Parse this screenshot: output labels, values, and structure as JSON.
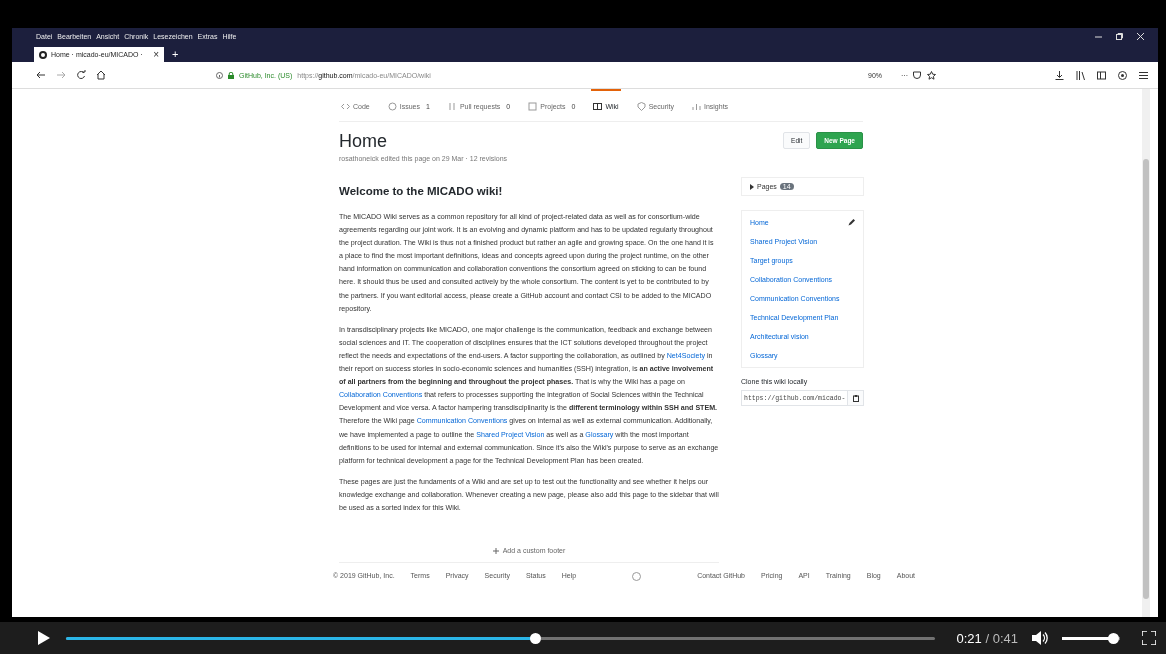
{
  "browser": {
    "menu": [
      "Datei",
      "Bearbeiten",
      "Ansicht",
      "Chronik",
      "Lesezeichen",
      "Extras",
      "Hilfe"
    ],
    "tab": {
      "title": "Home · micado-eu/MICADO ·",
      "close": "×"
    },
    "new_tab": "+",
    "address": {
      "site_info": "GitHub, Inc. (US)",
      "url_prefix": "https://",
      "url_host": "github.com",
      "url_path": "/micado-eu/MICADO/wiki",
      "zoom": "90%",
      "more": "···"
    }
  },
  "repo_nav": [
    {
      "label": "Code",
      "selected": false
    },
    {
      "label": "Issues",
      "count": "1",
      "selected": false
    },
    {
      "label": "Pull requests",
      "count": "0",
      "selected": false
    },
    {
      "label": "Projects",
      "count": "0",
      "selected": false
    },
    {
      "label": "Wiki",
      "selected": true
    },
    {
      "label": "Security",
      "selected": false
    },
    {
      "label": "Insights",
      "selected": false
    }
  ],
  "wiki": {
    "title": "Home",
    "meta": "rosathoneick edited this page on 29 Mar · 12 revisions",
    "edit_button": "Edit",
    "new_page_button": "New Page",
    "heading": "Welcome to the MICADO wiki!",
    "paragraphs": [
      [
        {
          "kind": "text",
          "text": "The MICADO Wiki serves as a common repository for all kind of project-related data as well as for consortium-wide agreements regarding our joint work. It is an evolving and dynamic platform and has to be updated regularly throughout the project duration. The Wiki is thus not a finished product but rather an agile and growing space. On the one hand it is a place to find the most important definitions, ideas and concepts agreed upon during the project runtime, on the other hand information on communication and collaboration conventions the consortium agreed on sticking to can be found here. It should thus be used and consulted actively by the whole consortium. The content is yet to be contributed to by the partners. If you want editorial access, please create a GitHub account and contact CSI to be added to the MICADO repository."
        }
      ],
      [
        {
          "kind": "text",
          "text": "In transdisciplinary projects like MICADO, one major challenge is the communication, feedback and exchange between social sciences and IT. The cooperation of disciplines ensures that the ICT solutions developed throughout the project reflect the needs and expectations of the end-users. A factor supporting the collaboration, as outlined by "
        },
        {
          "kind": "link",
          "text": "Net4Society"
        },
        {
          "kind": "text",
          "text": " in their report on success stories in socio-economic sciences and humanities (SSH) integration, is "
        },
        {
          "kind": "bold",
          "text": "an active involvement of all partners from the beginning and throughout the project phases."
        },
        {
          "kind": "text",
          "text": " That is why the Wiki has a page on "
        },
        {
          "kind": "link",
          "text": "Collaboration Conventions"
        },
        {
          "kind": "text",
          "text": " that refers to processes supporting the integration of Social Sciences within the Technical Development and vice versa. A factor hampering transdisciplinarity is the "
        },
        {
          "kind": "bold",
          "text": "different terminology within SSH and STEM."
        },
        {
          "kind": "text",
          "text": " Therefore the Wiki page "
        },
        {
          "kind": "link",
          "text": "Communication Conventions"
        },
        {
          "kind": "text",
          "text": " gives on internal as well as external communication. Additionally, we have implemented a page to outline the "
        },
        {
          "kind": "link",
          "text": "Shared Project Vision"
        },
        {
          "kind": "text",
          "text": " as well as a "
        },
        {
          "kind": "link",
          "text": "Glossary"
        },
        {
          "kind": "text",
          "text": " with the most important definitions to be used for internal and external communication. Since it's also the Wiki's purpose to serve as an exchange platform for technical development a page for the Technical Development Plan has been created."
        }
      ],
      [
        {
          "kind": "text",
          "text": "These pages are just the fundaments of a Wiki and are set up to test out the functionality and see whether it helps our knowledge exchange and collaboration. Whenever creating a new page, please also add this page to the sidebar that will be used as a sorted index for this Wiki."
        }
      ]
    ],
    "add_footer": "Add a custom footer"
  },
  "sidebar": {
    "pages_label": "Pages",
    "pages_count": "14",
    "pages": [
      {
        "label": "Home",
        "editable": true
      },
      {
        "label": "Shared Project Vision",
        "editable": false
      },
      {
        "label": "Target groups",
        "editable": false
      },
      {
        "label": "Collaboration Conventions",
        "editable": false
      },
      {
        "label": "Communication Conventions",
        "editable": false
      },
      {
        "label": "Technical Development Plan",
        "editable": false
      },
      {
        "label": "Architectural vision",
        "editable": false
      },
      {
        "label": "Glossary",
        "editable": false
      }
    ],
    "clone_heading": "Clone this wiki locally",
    "clone_url": "https://github.com/micado-"
  },
  "footer": [
    "© 2019 GitHub, Inc.",
    "Terms",
    "Privacy",
    "Security",
    "Status",
    "Help",
    "Contact GitHub",
    "Pricing",
    "API",
    "Training",
    "Blog",
    "About"
  ],
  "player": {
    "playing": false,
    "level": 0.54,
    "current_time": "0:21",
    "separator": "/",
    "duration": "0:41",
    "volume": {
      "level": 0.88
    }
  }
}
